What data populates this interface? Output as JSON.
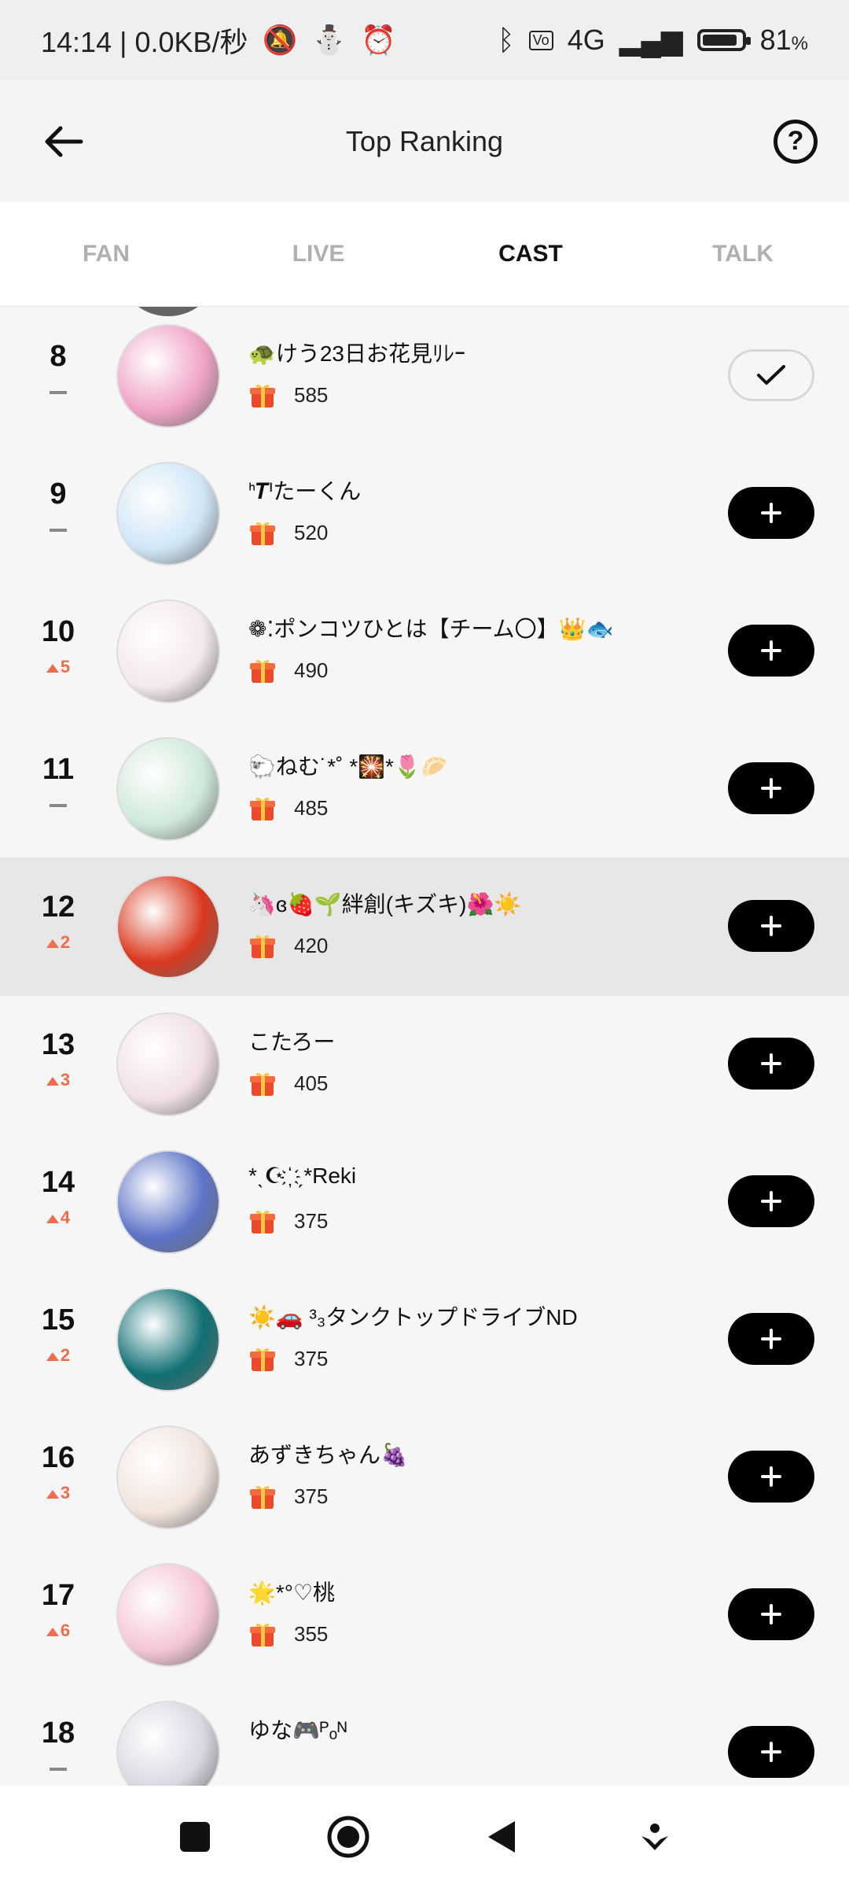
{
  "status": {
    "time_speed": "14:14 | 0.0KB/秒",
    "network": "4G",
    "battery": "81",
    "battery_suffix": "%",
    "battery_level": 0.81
  },
  "header": {
    "title": "Top Ranking"
  },
  "tabs": [
    {
      "label": "FAN",
      "active": false
    },
    {
      "label": "LIVE",
      "active": false
    },
    {
      "label": "CAST",
      "active": true
    },
    {
      "label": "TALK",
      "active": false
    }
  ],
  "rows": [
    {
      "rank": "8",
      "change": "",
      "name": "🐢けう23日お花見ﾘﾚｰ",
      "score": "585",
      "followed": true,
      "highlighted": false
    },
    {
      "rank": "9",
      "change": "",
      "name": "ᑋ𝑻ᑊたーくん",
      "score": "520",
      "followed": false,
      "highlighted": false
    },
    {
      "rank": "10",
      "change": "5",
      "name": "❁⁚ポンコツひとは【チーム〇】👑🐟",
      "score": "490",
      "followed": false,
      "highlighted": false
    },
    {
      "rank": "11",
      "change": "",
      "name": "🐑ねむ˙*˚ *🎇*🌷🥟",
      "score": "485",
      "followed": false,
      "highlighted": false
    },
    {
      "rank": "12",
      "change": "2",
      "name": "🦄ɞ🍓🌱絆創(キズキ)🌺☀️",
      "score": "420",
      "followed": false,
      "highlighted": true
    },
    {
      "rank": "13",
      "change": "3",
      "name": "こたろー",
      "score": "405",
      "followed": false,
      "highlighted": false
    },
    {
      "rank": "14",
      "change": "4",
      "name": "*ˎ☪︎ ҉ ˏ*Reki",
      "score": "375",
      "followed": false,
      "highlighted": false
    },
    {
      "rank": "15",
      "change": "2",
      "name": "☀️🚗 ³₃タンクトップドライブND",
      "score": "375",
      "followed": false,
      "highlighted": false
    },
    {
      "rank": "16",
      "change": "3",
      "name": "あずきちゃん🍇",
      "score": "375",
      "followed": false,
      "highlighted": false
    },
    {
      "rank": "17",
      "change": "6",
      "name": "🌟*°♡桃",
      "score": "355",
      "followed": false,
      "highlighted": false
    },
    {
      "rank": "18",
      "change": "",
      "name": "ゆな🎮ᴾₒᴺ",
      "score": "",
      "followed": false,
      "highlighted": false
    }
  ],
  "avatar_colors": [
    "#f0a3c6",
    "#cfe6f7",
    "#f3e8ee",
    "#cfe9d9",
    "#d9381e",
    "#f1dfe7",
    "#5d74c7",
    "#0f6f73",
    "#f2e4dc",
    "#f5c6d6",
    "#d8d8e2"
  ],
  "colors": {
    "accent": "#ef6c4c",
    "button": "#000000"
  },
  "icons": {
    "back": "arrow-left-icon",
    "help": "question-circle-icon",
    "gift": "gift-icon",
    "follow": "plus-icon",
    "followed": "check-icon"
  }
}
